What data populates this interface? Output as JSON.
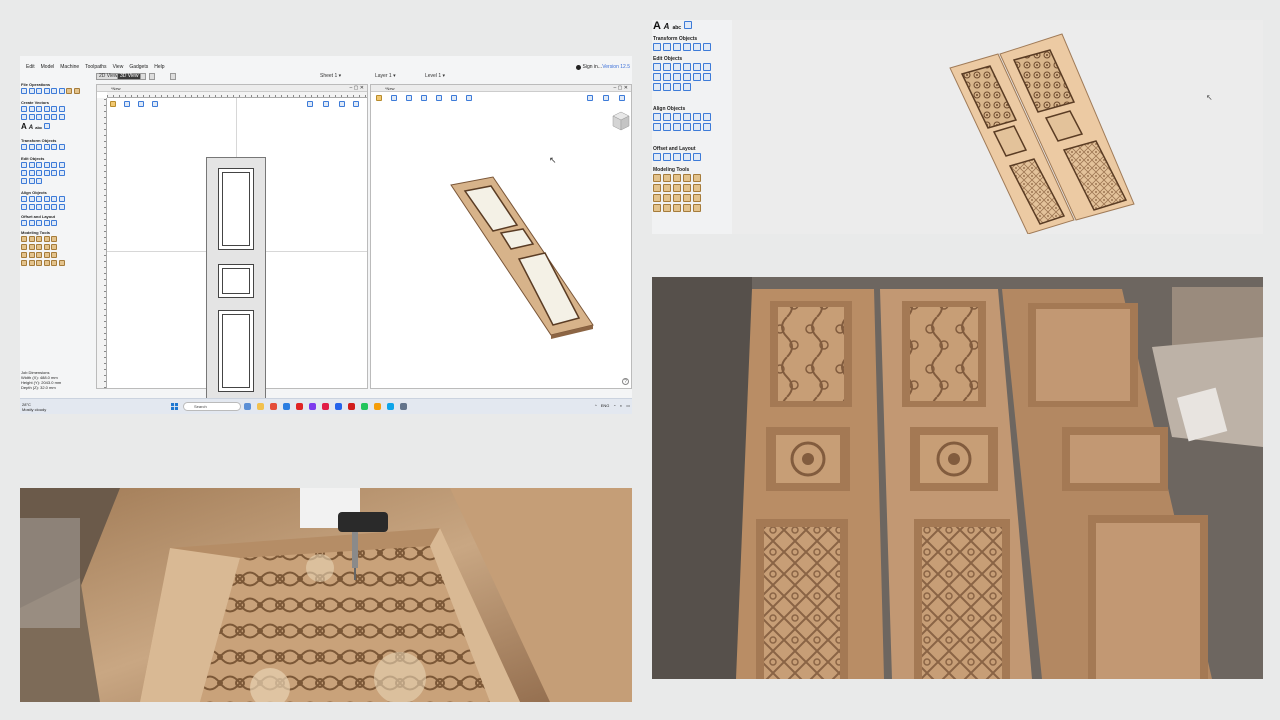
{
  "software": {
    "menu": [
      "Edit",
      "Model",
      "Machine",
      "Toolpaths",
      "View",
      "Gadgets",
      "Help"
    ],
    "sign_in": "Sign in...",
    "version": "Version 12.5",
    "view_tabs": {
      "view_2d": "2D View",
      "view_3d": "3D View"
    },
    "selectors": {
      "sheet": "Sheet 1",
      "layer": "Layer 1",
      "level": "Level 1"
    },
    "sections": {
      "file_ops": "File Operations",
      "create_vectors": "Create Vectors",
      "transform": "Transform Objects",
      "edit": "Edit Objects",
      "align": "Align Objects",
      "offset": "Offset and Layout",
      "modeling": "Modeling Tools"
    },
    "text_tools": [
      "A",
      "A",
      "abc"
    ],
    "dimensions": {
      "title": "Job Dimensions",
      "width": "Width (X): 488.0 mm",
      "height": "Height (Y): 2043.0 mm",
      "depth": "Depth (Z): 32.0 mm"
    },
    "view2d_tab": "*New",
    "view3d_tab": "*New",
    "taskbar": {
      "temp": "28°C",
      "weather": "Mostly cloudy",
      "search_placeholder": "Search",
      "lang": "ENG"
    }
  },
  "software_zoom": {
    "sections": {
      "transform": "Transform Objects",
      "edit": "Edit Objects",
      "align": "Align Objects",
      "offset": "Offset and Layout",
      "modeling": "Modeling Tools"
    },
    "text_tools": [
      "A",
      "A",
      "abc"
    ]
  },
  "photos": {
    "cnc": "cnc-carving-photo",
    "doors": "carved-wooden-doors-photo"
  },
  "colors": {
    "wood_light": "#e9c9a0",
    "wood_mid": "#c9a07a",
    "wood_dark": "#8c6544",
    "ui_blue": "#3d7bd8"
  }
}
